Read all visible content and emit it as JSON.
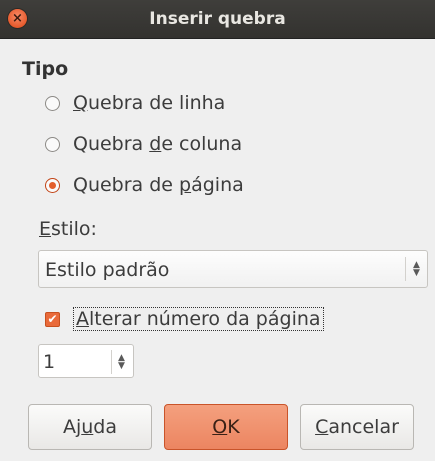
{
  "window": {
    "title": "Inserir quebra",
    "close_glyph": "×"
  },
  "tipo": {
    "heading": "Tipo",
    "options": [
      {
        "before": "",
        "mnemonic": "Q",
        "after": "uebra de  linha",
        "checked": false
      },
      {
        "before": "Quebra ",
        "mnemonic": "d",
        "after": "e coluna",
        "checked": false
      },
      {
        "before": "Quebra de ",
        "mnemonic": "p",
        "after": "ágina",
        "checked": true
      }
    ]
  },
  "estilo": {
    "label_mnemonic": "E",
    "label_rest": "stilo:",
    "selected": "Estilo padrão"
  },
  "page_number": {
    "checked": true,
    "label_mnemonic": "A",
    "label_rest": "lterar número da página",
    "value": "1"
  },
  "buttons": {
    "help": {
      "before": "Aj",
      "mnemonic": "u",
      "after": "da"
    },
    "ok": {
      "before": "",
      "mnemonic": "O",
      "after": "K"
    },
    "cancel": {
      "before": "",
      "mnemonic": "C",
      "after": "ancelar"
    }
  },
  "colors": {
    "accent": "#e96a3a",
    "titlebar": "#3b3a37"
  }
}
